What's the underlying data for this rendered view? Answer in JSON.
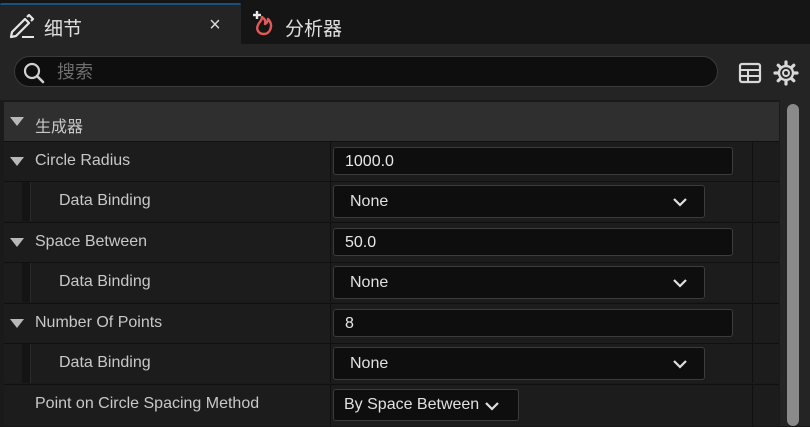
{
  "tabs": {
    "details": {
      "label": "细节",
      "close_glyph": "×"
    },
    "analyzer": {
      "label": "分析器"
    }
  },
  "search": {
    "placeholder": "搜索",
    "value": ""
  },
  "category": {
    "label": "生成器"
  },
  "properties": [
    {
      "label": "Circle Radius",
      "value": "1000.0"
    },
    {
      "label": "Data Binding",
      "value": "None"
    },
    {
      "label": "Space Between",
      "value": "50.0"
    },
    {
      "label": "Data Binding",
      "value": "None"
    },
    {
      "label": "Number Of Points",
      "value": "8"
    },
    {
      "label": "Data Binding",
      "value": "None"
    },
    {
      "label": "Point on Circle Spacing Method",
      "value": "By Space Between"
    }
  ],
  "colors": {
    "accent": "#1e4f7a",
    "analyzer_icon": "#e05a5a",
    "panel_bg": "#1c1c1c"
  },
  "icons": [
    "pencil-icon",
    "close-icon",
    "analyzer-flame-icon",
    "search-icon",
    "table-icon",
    "gear-icon",
    "chevron-down-icon"
  ]
}
